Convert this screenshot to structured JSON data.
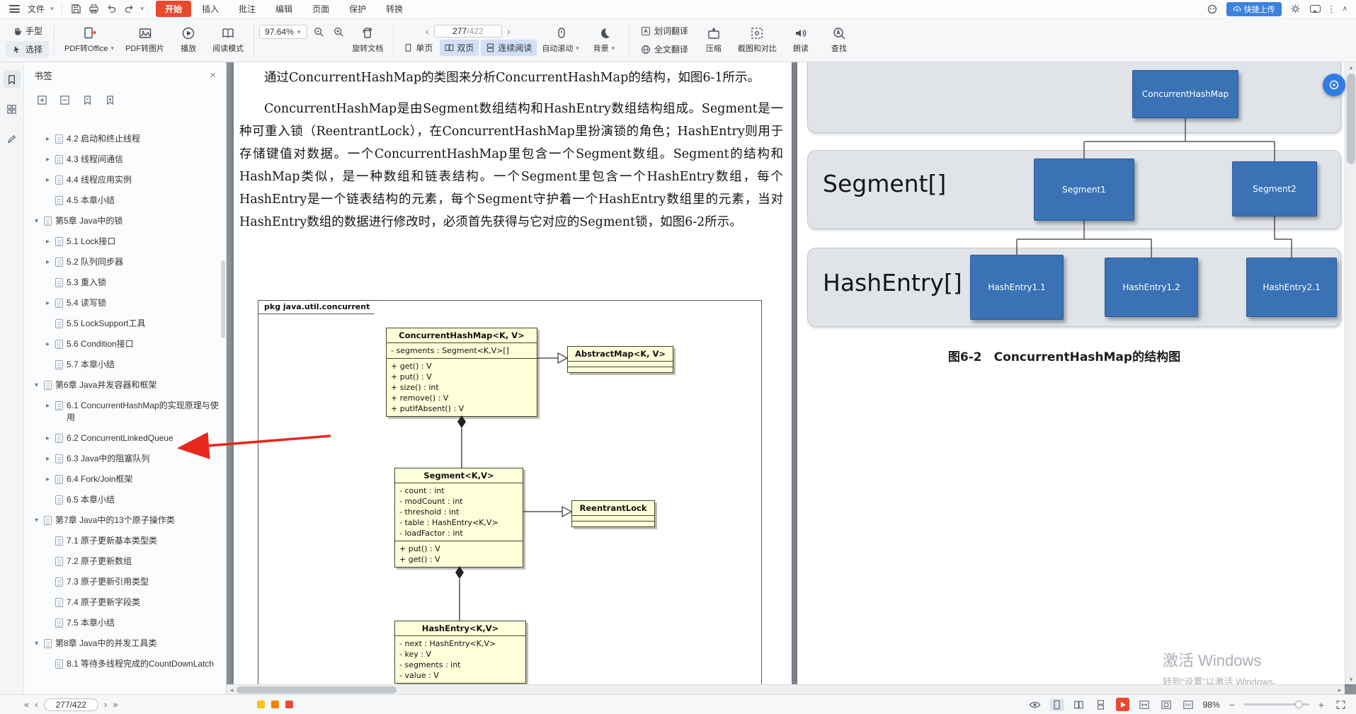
{
  "colors": {
    "accent": "#e8492f",
    "figure_blue": "#3a72b5",
    "band_gray": "#e0e4e9",
    "arrow_red": "#e8281e"
  },
  "menubar": {
    "file": "文件",
    "tabs": [
      {
        "label": "开始",
        "active": true
      },
      {
        "label": "插入"
      },
      {
        "label": "批注"
      },
      {
        "label": "编辑"
      },
      {
        "label": "页面"
      },
      {
        "label": "保护"
      },
      {
        "label": "转换"
      }
    ],
    "upload": "快捷上传"
  },
  "toolbar": {
    "hand": "手型",
    "select": "选择",
    "pdf_to_office": "PDF转Office",
    "pdf_to_image": "PDF转图片",
    "play": "播放",
    "read_mode": "阅读模式",
    "zoom": "97.64%",
    "rotate": "旋转文档",
    "page_current": "277",
    "page_total": "/422",
    "single": "单页",
    "double": "双页",
    "continuous": "连续阅读",
    "autoscroll": "自动滚动",
    "background": "背景",
    "word_trans": "划词翻译",
    "full_trans": "全文翻译",
    "compress": "压缩",
    "shot": "截图和对比",
    "read_aloud": "朗读",
    "find": "查找"
  },
  "sidebar": {
    "title": "书签",
    "items": [
      {
        "lvl": 1,
        "caret": "closed",
        "label": "4.2 启动和终止线程"
      },
      {
        "lvl": 1,
        "caret": "closed",
        "label": "4.3 线程间通信"
      },
      {
        "lvl": 1,
        "caret": "closed",
        "label": "4.4 线程应用实例"
      },
      {
        "lvl": 1,
        "caret": "none",
        "label": "4.5 本章小结"
      },
      {
        "lvl": 0,
        "caret": "open",
        "label": "第5章 Java中的锁"
      },
      {
        "lvl": 1,
        "caret": "closed",
        "label": "5.1 Lock接口"
      },
      {
        "lvl": 1,
        "caret": "closed",
        "label": "5.2 队列同步器"
      },
      {
        "lvl": 1,
        "caret": "none",
        "label": "5.3 重入锁"
      },
      {
        "lvl": 1,
        "caret": "closed",
        "label": "5.4 读写锁"
      },
      {
        "lvl": 1,
        "caret": "none",
        "label": "5.5 LockSupport工具"
      },
      {
        "lvl": 1,
        "caret": "closed",
        "label": "5.6 Condition接口"
      },
      {
        "lvl": 1,
        "caret": "none",
        "label": "5.7 本章小结"
      },
      {
        "lvl": 0,
        "caret": "open",
        "label": "第6章 Java并发容器和框架"
      },
      {
        "lvl": 1,
        "caret": "closed",
        "label": "6.1 ConcurrentHashMap的实现原理与使用"
      },
      {
        "lvl": 1,
        "caret": "closed",
        "label": "6.2 ConcurrentLinkedQueue"
      },
      {
        "lvl": 1,
        "caret": "closed",
        "label": "6.3 Java中的阻塞队列"
      },
      {
        "lvl": 1,
        "caret": "closed",
        "label": "6.4 Fork/Join框架"
      },
      {
        "lvl": 1,
        "caret": "none",
        "label": "6.5 本章小结"
      },
      {
        "lvl": 0,
        "caret": "open",
        "label": "第7章 Java中的13个原子操作类"
      },
      {
        "lvl": 1,
        "caret": "none",
        "label": "7.1 原子更新基本类型类"
      },
      {
        "lvl": 1,
        "caret": "none",
        "label": "7.2 原子更新数组"
      },
      {
        "lvl": 1,
        "caret": "none",
        "label": "7.3 原子更新引用类型"
      },
      {
        "lvl": 1,
        "caret": "none",
        "label": "7.4 原子更新字段类"
      },
      {
        "lvl": 1,
        "caret": "none",
        "label": "7.5 本章小结"
      },
      {
        "lvl": 0,
        "caret": "open",
        "label": "第8章 Java中的并发工具类"
      },
      {
        "lvl": 1,
        "caret": "none",
        "label": "8.1 等待多线程完成的CountDownLatch"
      }
    ]
  },
  "doc": {
    "para1": "通过ConcurrentHashMap的类图来分析ConcurrentHashMap的结构，如图6-1所示。",
    "para2": "ConcurrentHashMap是由Segment数组结构和HashEntry数组结构组成。Segment是一种可重入锁（ReentrantLock），在ConcurrentHashMap里扮演锁的角色；HashEntry则用于存储键值对数据。一个ConcurrentHashMap里包含一个Segment数组。Segment的结构和HashMap类似，是一种数组和链表结构。一个Segment里包含一个HashEntry数组，每个HashEntry是一个链表结构的元素，每个Segment守护着一个HashEntry数组里的元素，当对HashEntry数组的数据进行修改时，必须首先获得与它对应的Segment锁，如图6-2所示。",
    "uml": {
      "frame": "pkg java.util.concurrent",
      "chm_title": "ConcurrentHashMap<K, V>",
      "chm_fields": [
        "- segments : Segment<K,V>[]"
      ],
      "chm_methods": [
        "+ get() : V",
        "+ put() : V",
        "+ size() : int",
        "+ remove() : V",
        "+ putIfAbsent() : V"
      ],
      "abstract_title": "AbstractMap<K, V>",
      "segment_title": "Segment<K,V>",
      "segment_fields": [
        "- count : int",
        "- modCount : int",
        "- threshold : int",
        "- table : HashEntry<K,V>",
        "- loadFactor : int"
      ],
      "segment_methods": [
        "+ put() : V",
        "+ get() : V"
      ],
      "lock_title": "ReentrantLock",
      "he_title": "HashEntry<K,V>",
      "he_fields": [
        "- next : HashEntry<K,V>",
        "- key : V",
        "- segments : int",
        "- value : V"
      ]
    },
    "fig": {
      "root": "ConcurrentHashMap",
      "segment_label": "Segment[]",
      "segments": [
        "Segment1",
        "Segment2"
      ],
      "he_label": "HashEntry[]",
      "hashentries": [
        "HashEntry1.1",
        "HashEntry1.2",
        "HashEntry2.1"
      ],
      "caption": "图6-2　ConcurrentHashMap的结构图"
    }
  },
  "watermark": {
    "l1": "激活 Windows",
    "l2": "转到“设置”以激活 Windows。"
  },
  "statusbar": {
    "page": "277/422",
    "zoom": "98%",
    "chips": [
      "#f5c518",
      "#f08300",
      "#e84c3d"
    ]
  }
}
